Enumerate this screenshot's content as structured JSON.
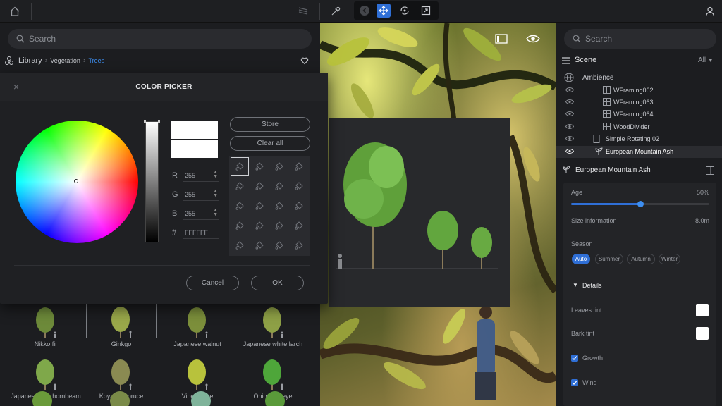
{
  "top_bar": {
    "icons": [
      "home-icon",
      "layers-icon",
      "eyedropper-icon",
      "back-icon",
      "move-icon",
      "rotate-icon",
      "scale-icon",
      "user-icon"
    ]
  },
  "library": {
    "search_placeholder": "Search",
    "breadcrumb": [
      "Library",
      "Vegetation",
      "Trees"
    ],
    "assets": [
      {
        "name": "Nikko fir",
        "color": "#6d8a3a"
      },
      {
        "name": "Ginkgo",
        "color": "#9aa84a"
      },
      {
        "name": "Japanese walnut",
        "color": "#7c8f3b"
      },
      {
        "name": "Japanese white larch",
        "color": "#8ea046"
      },
      {
        "name": "Japanese hop hornbeam",
        "color": "#7fa84a"
      },
      {
        "name": "Koyama spruce",
        "color": "#8a8a52"
      },
      {
        "name": "Vine maple",
        "color": "#b8c23c"
      },
      {
        "name": "Ohio buckeye",
        "color": "#4ea63a"
      }
    ]
  },
  "color_picker": {
    "title": "COLOR PICKER",
    "r_label": "R",
    "g_label": "G",
    "b_label": "B",
    "hex_label": "#",
    "r": "255",
    "g": "255",
    "b": "255",
    "hex": "FFFFFF",
    "store": "Store",
    "clear_all": "Clear all",
    "cancel": "Cancel",
    "ok": "OK",
    "current_color": "#ffffff",
    "previous_color": "#ffffff"
  },
  "scene": {
    "search_placeholder": "Search",
    "title": "Scene",
    "filter": "All",
    "ambience": "Ambience",
    "items": [
      {
        "label": "WFraming062"
      },
      {
        "label": "WFraming063"
      },
      {
        "label": "WFraming064"
      },
      {
        "label": "WoodDivider"
      },
      {
        "label": "Simple Rotating 02"
      },
      {
        "label": "European Mountain Ash"
      }
    ]
  },
  "properties": {
    "title": "European Mountain Ash",
    "age_label": "Age",
    "age_value": "50%",
    "age_fraction": 0.5,
    "size_label": "Size information",
    "size_value": "8.0m",
    "season_label": "Season",
    "seasons": [
      "Auto",
      "Summer",
      "Autumn",
      "Winter"
    ],
    "active_season": "Auto",
    "details_label": "Details",
    "leaves_tint_label": "Leaves tint",
    "bark_tint_label": "Bark tint",
    "growth_label": "Growth",
    "wind_label": "Wind",
    "leaves_tint_color": "#ffffff",
    "bark_tint_color": "#ffffff"
  },
  "colors": {
    "accent": "#2f6fd6",
    "link": "#3d8ef0"
  }
}
